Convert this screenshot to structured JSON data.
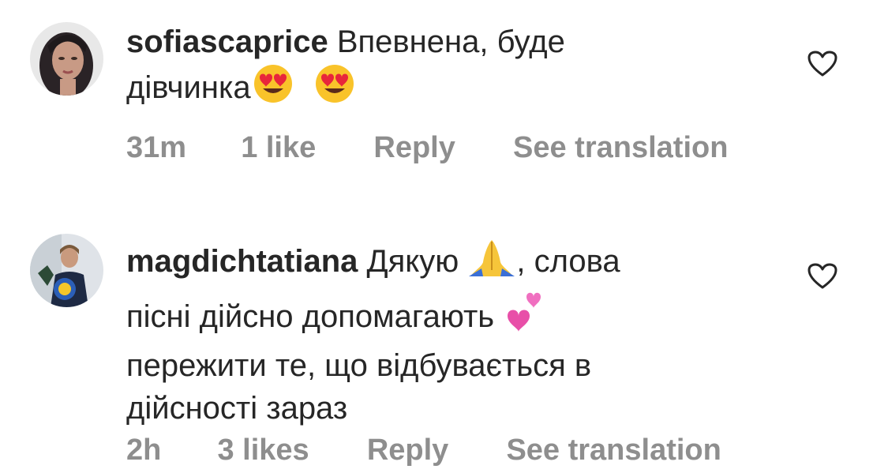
{
  "comments": [
    {
      "username": "sofiascaprice",
      "text_line1": "Впевнена, буде",
      "text_line2": "дівчинка",
      "emojis": [
        "heart-eyes",
        "heart-eyes"
      ],
      "time": "31m",
      "likes": "1 like",
      "reply": "Reply",
      "translate": "See translation"
    },
    {
      "username": "magdichtatiana",
      "text_part1": "Дякую",
      "text_part2": ", слова",
      "text_line2": "пісні дійсно допомагають",
      "text_line3": "пережити те, що відбувається в",
      "text_line4": "дійсності зараз",
      "emojis": [
        "folded-hands",
        "two-hearts"
      ],
      "time": "2h",
      "likes": "3 likes",
      "reply": "Reply",
      "translate": "See translation"
    }
  ],
  "colors": {
    "text": "#262626",
    "meta": "#8e8e8e",
    "heart_outline": "#262626"
  }
}
